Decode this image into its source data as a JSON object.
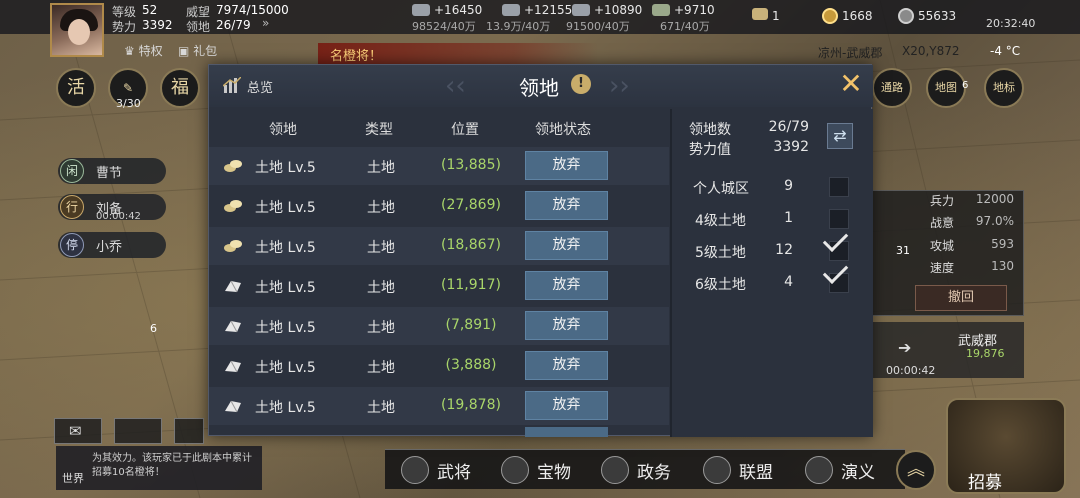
{
  "player": {
    "level_label": "等级",
    "level": "52",
    "power_label": "势力",
    "power": "3392",
    "prestige_label": "威望",
    "prestige": "7974/15000",
    "territory_label": "领地",
    "territory": "26/79"
  },
  "resources": [
    {
      "name": "wood",
      "gain": "+16450",
      "stock": "98524/40万"
    },
    {
      "name": "iron",
      "gain": "+12155",
      "stock": "13.9万/40万"
    },
    {
      "name": "stone",
      "gain": "+10890",
      "stock": "91500/40万"
    },
    {
      "name": "grain",
      "gain": "+9710",
      "stock": "671/40万"
    }
  ],
  "currency": {
    "token": "1",
    "gold": "1668",
    "copper": "55633"
  },
  "clock": "20:32:40",
  "hud2": {
    "privilege": "特权",
    "gift": "礼包",
    "banner": "名橙将！",
    "location": "凉州-武威郡",
    "coords": "X20,Y872",
    "weather": "-4 °C"
  },
  "left_buttons": {
    "activity": "活",
    "counter": "3/30",
    "fortune": "福"
  },
  "left_list": [
    {
      "icon": "闲",
      "name": "曹节"
    },
    {
      "icon": "行",
      "name": "刘备"
    },
    {
      "icon": "停",
      "name": "小乔"
    }
  ],
  "left_timer": "00:00:42",
  "left_badge": "6",
  "right_nav": {
    "road": "通路",
    "map": "地图",
    "marker": "地标",
    "map_badge": "6"
  },
  "general": {
    "level_badge": "31",
    "stats": [
      {
        "label": "兵力",
        "value": "12000"
      },
      {
        "label": "战意",
        "value": "97.0%"
      },
      {
        "label": "攻城",
        "value": "593"
      },
      {
        "label": "速度",
        "value": "130"
      }
    ],
    "retreat": "撤回",
    "target": "武威郡",
    "target_coord": "19,876",
    "march_timer": "00:00:42"
  },
  "chat": {
    "channel": "世界",
    "message": "为其效力。该玩家已于此剧本中累计招募10名橙将！"
  },
  "bottom_nav": [
    "武将",
    "宝物",
    "政务",
    "联盟",
    "演义"
  ],
  "recruit": "招募",
  "modal": {
    "summary": "总览",
    "title": "领地",
    "columns": [
      "领地",
      "类型",
      "位置",
      "领地状态"
    ],
    "rows": [
      {
        "name": "土地 Lv.5",
        "type": "土地",
        "pos": "(13,885)",
        "action": "放弃",
        "icon": "gold"
      },
      {
        "name": "土地 Lv.5",
        "type": "土地",
        "pos": "(27,869)",
        "action": "放弃",
        "icon": "gold"
      },
      {
        "name": "土地 Lv.5",
        "type": "土地",
        "pos": "(18,867)",
        "action": "放弃",
        "icon": "gold"
      },
      {
        "name": "土地 Lv.5",
        "type": "土地",
        "pos": "(11,917)",
        "action": "放弃",
        "icon": "silver"
      },
      {
        "name": "土地 Lv.5",
        "type": "土地",
        "pos": "(7,891)",
        "action": "放弃",
        "icon": "silver"
      },
      {
        "name": "土地 Lv.5",
        "type": "土地",
        "pos": "(3,888)",
        "action": "放弃",
        "icon": "silver"
      },
      {
        "name": "土地 Lv.5",
        "type": "土地",
        "pos": "(19,878)",
        "action": "放弃",
        "icon": "silver"
      }
    ],
    "stats": {
      "count_label": "领地数",
      "count": "26/79",
      "power_label": "势力值",
      "power": "3392"
    },
    "filters": [
      {
        "label": "个人城区",
        "count": "9",
        "checked": false
      },
      {
        "label": "4级土地",
        "count": "1",
        "checked": false
      },
      {
        "label": "5级土地",
        "count": "12",
        "checked": true
      },
      {
        "label": "6级土地",
        "count": "4",
        "checked": true
      }
    ]
  }
}
